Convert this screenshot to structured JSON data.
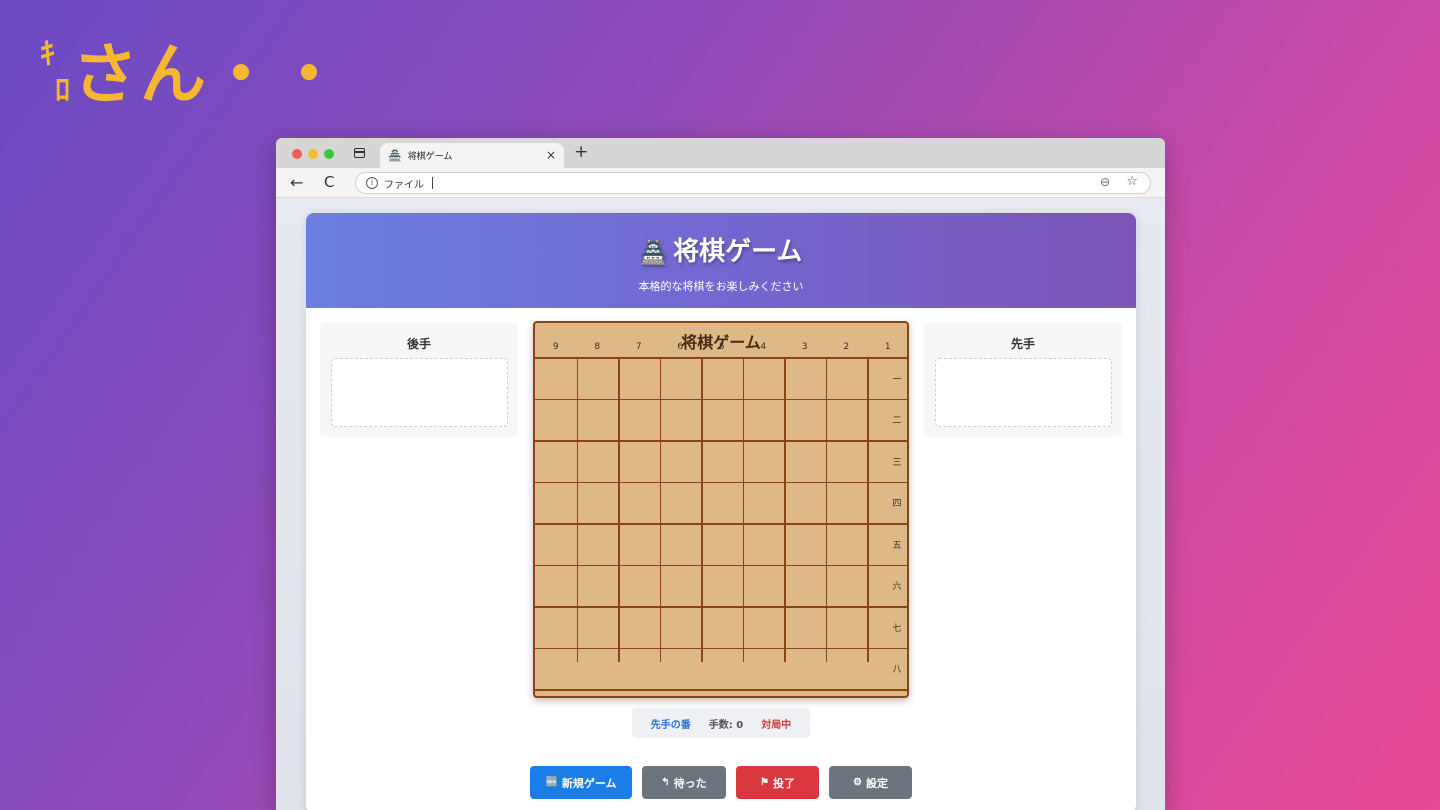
{
  "slide": {
    "title_small_1": "ｷ",
    "title_small_2": "ﾛ",
    "title_main": "さん・・"
  },
  "browser": {
    "tab_title": "将棋ゲーム",
    "tab_icon": "🏯",
    "tab_close": "×",
    "new_tab": "+",
    "address_scheme": "ファイル",
    "back": "←",
    "reload": "C"
  },
  "app": {
    "title_icon": "🏯",
    "title": "将棋ゲーム",
    "subtitle": "本格的な将棋をお楽しみください",
    "gote_label": "後手",
    "sente_label": "先手",
    "board_title": "将棋ゲーム",
    "column_numbers": [
      "9",
      "8",
      "7",
      "6",
      "5",
      "4",
      "3",
      "2",
      "1"
    ],
    "row_numbers": [
      "一",
      "二",
      "三",
      "四",
      "五",
      "六",
      "七",
      "八"
    ],
    "status": {
      "turn": "先手の番",
      "moves": "手数: 0",
      "state": "対局中"
    },
    "buttons": {
      "new_game": "新規ゲーム",
      "undo": "待った",
      "resign": "投了",
      "settings": "設定"
    },
    "colors": {
      "board": "#deb887",
      "grid": "#8b4513",
      "primary": "#1a7de8",
      "danger": "#d9363e",
      "secondary": "#6c757d",
      "accent_title": "#f5b731"
    }
  }
}
